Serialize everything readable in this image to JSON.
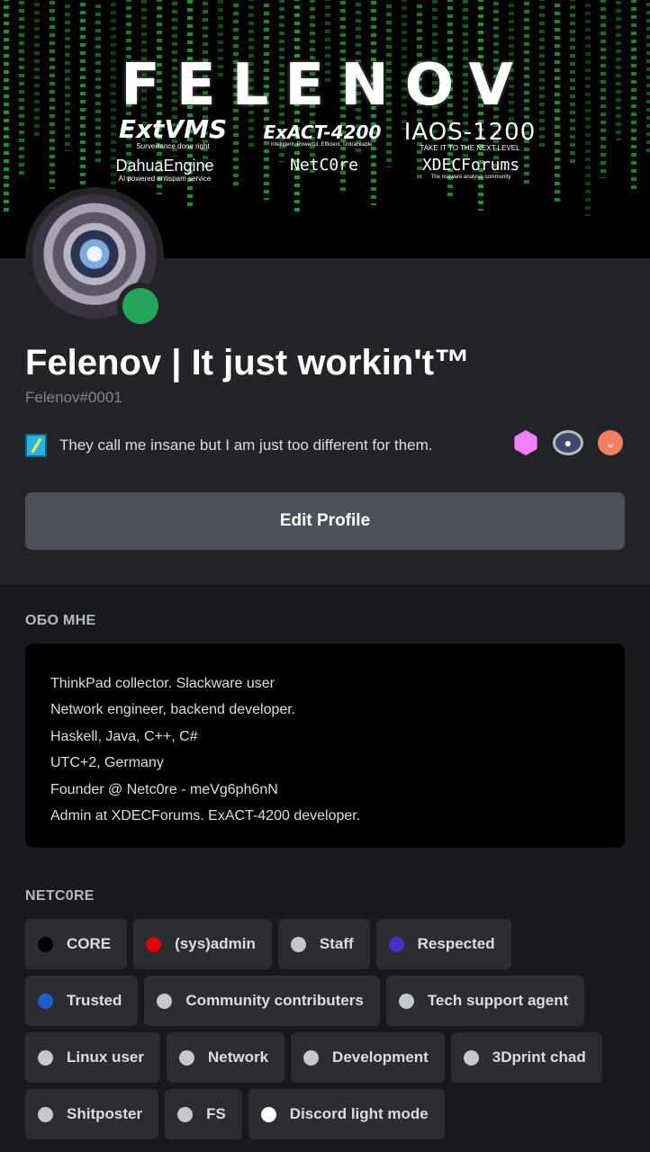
{
  "banner": {
    "title": "FELENOV",
    "logos": [
      {
        "name": "ExtVMS",
        "tagline": "Surveillance done right"
      },
      {
        "name": "ExACT-4200",
        "tagline": "Intelligent. Powerful. Efficient. Untraceable."
      },
      {
        "name": "IAOS-1200",
        "tagline": "TAKE IT TO THE NEXT LEVEL"
      },
      {
        "name": "DahuaEngine",
        "tagline": "AI powered antispam service"
      },
      {
        "name": "NetC0re",
        "tagline": ""
      },
      {
        "name": "XDECForums",
        "tagline": "The malware analysis community"
      }
    ]
  },
  "profile": {
    "display_name": "Felenov | It just workin't™",
    "username": "Felenov#0001",
    "status_color": "#23a55a",
    "custom_status": "They call me insane but I am just too different for them.",
    "badges": [
      "nitro-badge-icon",
      "server-boost-badge-icon",
      "hypesquad-badge-icon"
    ],
    "edit_button_label": "Edit Profile"
  },
  "about": {
    "label": "ОБО МНЕ",
    "lines": [
      "ThinkPad collector. Slackware user",
      "Network engineer, backend developer.",
      "Haskell, Java, C++, C#",
      "UTC+2, Germany",
      "Founder @ Netc0re - meVg6ph6nN",
      "Admin at XDECForums. ExACT-4200 developer."
    ]
  },
  "roles_section": {
    "label": "NETC0RE",
    "roles": [
      {
        "name": "CORE",
        "color": "#000000"
      },
      {
        "name": "(sys)admin",
        "color": "#e00000"
      },
      {
        "name": "Staff",
        "color": "#c4c9ce"
      },
      {
        "name": "Respected",
        "color": "#4a2fc7"
      },
      {
        "name": "Trusted",
        "color": "#1e5fcf"
      },
      {
        "name": "Community contributers",
        "color": "#c4c9ce"
      },
      {
        "name": "Tech support agent",
        "color": "#c4c9ce"
      },
      {
        "name": "Linux user",
        "color": "#c4c9ce"
      },
      {
        "name": "Network",
        "color": "#c4c9ce"
      },
      {
        "name": "Development",
        "color": "#c4c9ce"
      },
      {
        "name": "3Dprint chad",
        "color": "#c4c9ce"
      },
      {
        "name": "Shitposter",
        "color": "#c4c9ce"
      },
      {
        "name": "FS",
        "color": "#c4c9ce"
      },
      {
        "name": "Discord light mode",
        "color": "#ffffff"
      }
    ]
  }
}
